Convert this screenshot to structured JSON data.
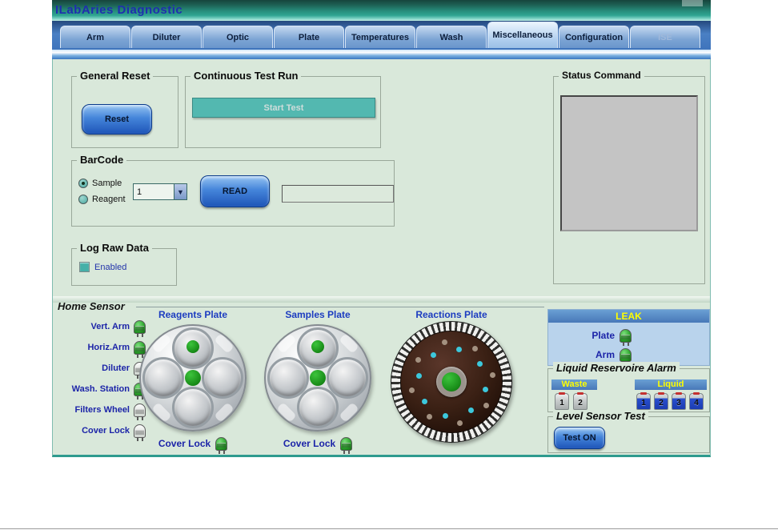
{
  "window": {
    "title": "ILabAries Diagnostic"
  },
  "tabs": {
    "items": [
      {
        "label": "Arm"
      },
      {
        "label": "Diluter"
      },
      {
        "label": "Optic"
      },
      {
        "label": "Plate"
      },
      {
        "label": "Temperatures"
      },
      {
        "label": "Wash"
      },
      {
        "label": "Miscellaneous",
        "selected": true
      },
      {
        "label": "Configuration"
      },
      {
        "label": "ISE",
        "disabled": true
      }
    ]
  },
  "general_reset": {
    "title": "General Reset",
    "reset_button": "Reset"
  },
  "continuous_test_run": {
    "title": "Continuous Test Run",
    "start_button": "Start Test"
  },
  "barcode": {
    "title": "BarCode",
    "sample_radio": "Sample",
    "reagent_radio": "Reagent",
    "selected_option": "Sample",
    "dropdown_value": "1",
    "read_button": "READ",
    "result_field": ""
  },
  "log_raw_data": {
    "title": "Log Raw Data",
    "enabled_checkbox": "Enabled",
    "checked": true
  },
  "status_command": {
    "title": "Status Command",
    "content": ""
  },
  "home_sensor": {
    "title": "Home Sensor",
    "items": [
      {
        "label": "Vert. Arm",
        "state": "on"
      },
      {
        "label": "Horiz.Arm",
        "state": "on"
      },
      {
        "label": "Diluter",
        "state": "off"
      },
      {
        "label": "Wash. Station",
        "state": "on"
      },
      {
        "label": "Filters Wheel",
        "state": "off"
      },
      {
        "label": "Cover Lock",
        "state": "off"
      }
    ]
  },
  "plates": {
    "reagents": {
      "label": "Reagents Plate",
      "cover_lock_label": "Cover Lock",
      "cover_lock_state": "on"
    },
    "samples": {
      "label": "Samples Plate",
      "cover_lock_label": "Cover Lock",
      "cover_lock_state": "on"
    },
    "reactions": {
      "label": "Reactions Plate",
      "dots": {
        "count": 16,
        "inner_radius": 42,
        "outer_radius": 51,
        "colors": [
          "#3cc8dc",
          "#a39180"
        ]
      }
    }
  },
  "leak": {
    "title": "LEAK",
    "items": [
      {
        "label": "Plate",
        "state": "on"
      },
      {
        "label": "Arm",
        "state": "on"
      }
    ]
  },
  "liquid_reservoir": {
    "title": "Liquid Reservoire Alarm",
    "waste": {
      "label": "Waste",
      "tanks": [
        "1",
        "2"
      ]
    },
    "liquid": {
      "label": "Liquid",
      "tanks": [
        "1",
        "2",
        "3",
        "4"
      ]
    }
  },
  "level_sensor_test": {
    "title": "Level Sensor Test",
    "test_button": "Test ON"
  },
  "colors": {
    "led_on": "#2ca52c",
    "accent_button_blue": "#2e6fd4",
    "teal_button": "#53b8b0",
    "header_yellow": "#ffff00",
    "leak_panel_blue": "#b9d3ec",
    "client_background": "#d9e8da"
  }
}
